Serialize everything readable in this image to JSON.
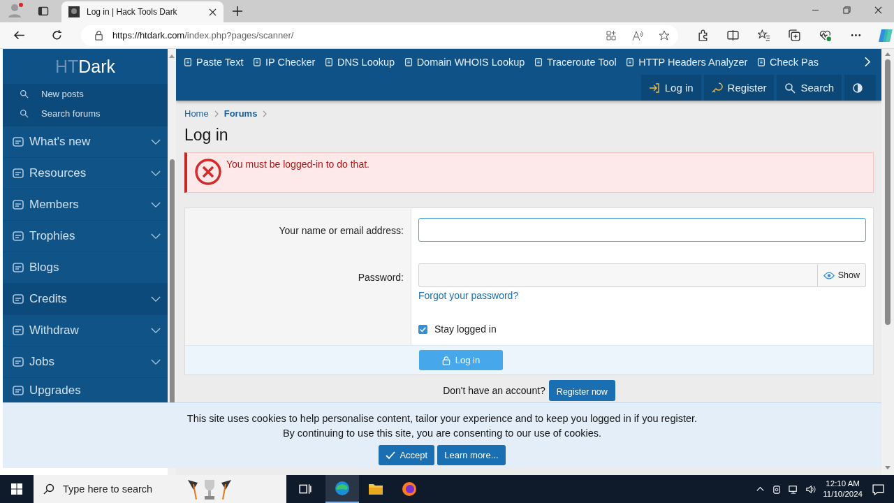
{
  "browser": {
    "tabs": [
      {
        "title": "Log in | Hack Tools Dark",
        "selected": true
      }
    ],
    "url_host": "https://htdark.com",
    "url_path": "/index.php?pages/scanner/"
  },
  "logo": {
    "light": "HT",
    "bold": "Dark"
  },
  "sidebar": {
    "subitems": [
      "New posts",
      "Search forums"
    ],
    "items": [
      {
        "label": "What's new",
        "expandable": true,
        "highlighted": false
      },
      {
        "label": "Resources",
        "expandable": true,
        "highlighted": false
      },
      {
        "label": "Members",
        "expandable": true,
        "highlighted": false
      },
      {
        "label": "Trophies",
        "expandable": true,
        "highlighted": false
      },
      {
        "label": "Blogs",
        "expandable": false,
        "highlighted": false
      },
      {
        "label": "Credits",
        "expandable": true,
        "highlighted": true
      },
      {
        "label": "Withdraw",
        "expandable": true,
        "highlighted": false
      },
      {
        "label": "Jobs",
        "expandable": true,
        "highlighted": false
      },
      {
        "label": "Upgrades",
        "expandable": false,
        "highlighted": false
      }
    ]
  },
  "top_links": [
    "Paste Text",
    "IP Checker",
    "DNS Lookup",
    "Domain WHOIS Lookup",
    "Traceroute Tool",
    "HTTP Headers Analyzer",
    "Check Pas"
  ],
  "header_buttons": [
    "Log in",
    "Register",
    "Search"
  ],
  "breadcrumb": [
    {
      "label": "Home",
      "bold": false
    },
    {
      "label": "Forums",
      "bold": true
    }
  ],
  "title": "Log in",
  "error": "You must be logged-in to do that.",
  "form": {
    "name_label": "Your name or email address:",
    "password_label": "Password:",
    "show_label": "Show",
    "forgot": "Forgot your password?",
    "stay": {
      "label": "Stay logged in",
      "checked": true
    },
    "submit": "Log in",
    "no_account": "Don't have an account?",
    "register": "Register now"
  },
  "cookie": {
    "lines": [
      "This site uses cookies to help personalise content, tailor your experience and to keep you logged in if you register.",
      "By continuing to use this site, you are consenting to our use of cookies."
    ],
    "accept": "Accept",
    "learn": "Learn more..."
  },
  "taskbar": {
    "search_placeholder": "Type here to search",
    "time": "12:10 AM",
    "date": "11/10/2024"
  }
}
